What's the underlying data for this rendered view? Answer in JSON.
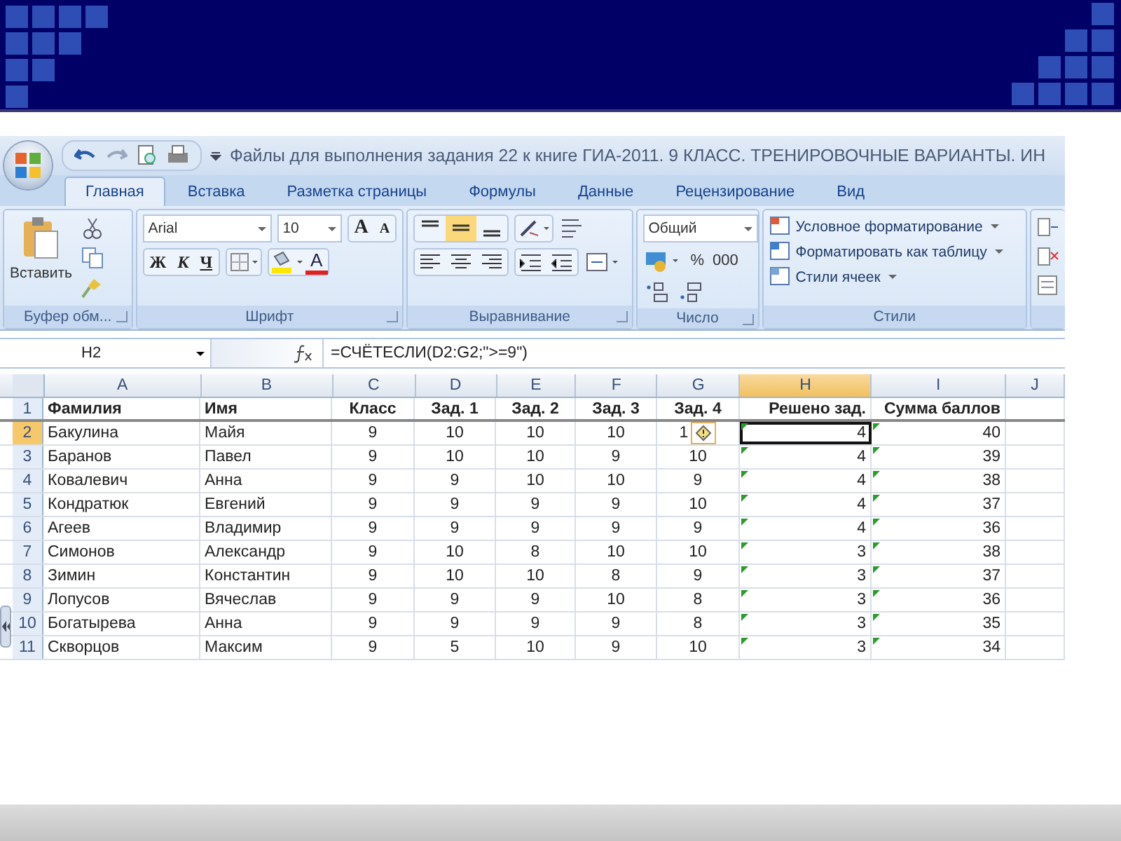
{
  "excel": {
    "title": "Файлы для выполнения задания 22 к книге ГИА-2011. 9 КЛАСС. ТРЕНИРОВОЧНЫЕ ВАРИАНТЫ. ИН",
    "tabs": [
      {
        "label": "Главная",
        "selected": true
      },
      {
        "label": "Вставка",
        "selected": false
      },
      {
        "label": "Разметка страницы",
        "selected": false
      },
      {
        "label": "Формулы",
        "selected": false
      },
      {
        "label": "Данные",
        "selected": false
      },
      {
        "label": "Рецензирование",
        "selected": false
      },
      {
        "label": "Вид",
        "selected": false
      }
    ],
    "clipboard": {
      "paste": "Вставить",
      "group": "Буфер обм..."
    },
    "font": {
      "family": "Arial",
      "size": "10",
      "grow": "A",
      "shrink": "A",
      "bold": "Ж",
      "italic": "К",
      "underline": "Ч",
      "font_color": "A",
      "group": "Шрифт"
    },
    "alignment": {
      "vertical": [
        {
          "kind": "top",
          "selected": false
        },
        {
          "kind": "middle",
          "selected": true
        },
        {
          "kind": "bottom",
          "selected": false
        }
      ],
      "group": "Выравнивание"
    },
    "number": {
      "format": "Общий",
      "percent": "%",
      "thousands": "000",
      "group": "Число"
    },
    "styles": {
      "items": [
        "Условное форматирование",
        "Форматировать как таблицу",
        "Стили ячеек"
      ],
      "group": "Стили"
    },
    "name_box": "H2",
    "formula": "=СЧЁТЕСЛИ(D2:G2;\">=9\")",
    "columns": [
      {
        "letter": "A",
        "selected": false,
        "kind": "text",
        "flagged": false
      },
      {
        "letter": "B",
        "selected": false,
        "kind": "text",
        "flagged": false
      },
      {
        "letter": "C",
        "selected": false,
        "kind": "score",
        "flagged": false
      },
      {
        "letter": "D",
        "selected": false,
        "kind": "score",
        "flagged": false
      },
      {
        "letter": "E",
        "selected": false,
        "kind": "score",
        "flagged": false
      },
      {
        "letter": "F",
        "selected": false,
        "kind": "score",
        "flagged": false
      },
      {
        "letter": "G",
        "selected": false,
        "kind": "score",
        "flagged": false
      },
      {
        "letter": "H",
        "selected": true,
        "kind": "result",
        "flagged": true
      },
      {
        "letter": "I",
        "selected": false,
        "kind": "result",
        "flagged": true
      },
      {
        "letter": "J",
        "selected": false,
        "kind": "text",
        "flagged": false
      }
    ],
    "rows": [
      {
        "number": "1",
        "selected": false,
        "kind": "header",
        "cells": [
          "Фамилия",
          "Имя",
          "Класс",
          "Зад. 1",
          "Зад. 2",
          "Зад. 3",
          "Зад. 4",
          "Решено зад.",
          "Сумма баллов"
        ]
      },
      {
        "number": "2",
        "selected": true,
        "kind": "data",
        "cells": [
          "Бакулина",
          "Майя",
          "9",
          "10",
          "10",
          "10",
          {
            "text": "1",
            "smart_tag": true
          },
          "4",
          "40"
        ]
      },
      {
        "number": "3",
        "selected": false,
        "kind": "data",
        "cells": [
          "Баранов",
          "Павел",
          "9",
          "10",
          "10",
          "9",
          "10",
          "4",
          "39"
        ]
      },
      {
        "number": "4",
        "selected": false,
        "kind": "data",
        "cells": [
          "Ковалевич",
          "Анна",
          "9",
          "9",
          "10",
          "10",
          "9",
          "4",
          "38"
        ]
      },
      {
        "number": "5",
        "selected": false,
        "kind": "data",
        "cells": [
          "Кондратюк",
          "Евгений",
          "9",
          "9",
          "9",
          "9",
          "10",
          "4",
          "37"
        ]
      },
      {
        "number": "6",
        "selected": false,
        "kind": "data",
        "cells": [
          "Агеев",
          "Владимир",
          "9",
          "9",
          "9",
          "9",
          "9",
          "4",
          "36"
        ]
      },
      {
        "number": "7",
        "selected": false,
        "kind": "data",
        "cells": [
          "Симонов",
          "Александр",
          "9",
          "10",
          "8",
          "10",
          "10",
          "3",
          "38"
        ]
      },
      {
        "number": "8",
        "selected": false,
        "kind": "data",
        "cells": [
          "Зимин",
          "Константин",
          "9",
          "10",
          "10",
          "8",
          "9",
          "3",
          "37"
        ]
      },
      {
        "number": "9",
        "selected": false,
        "kind": "data",
        "cells": [
          "Лопусов",
          "Вячеслав",
          "9",
          "9",
          "9",
          "10",
          "8",
          "3",
          "36"
        ]
      },
      {
        "number": "10",
        "selected": false,
        "kind": "data",
        "cells": [
          "Богатырева",
          "Анна",
          "9",
          "9",
          "9",
          "9",
          "8",
          "3",
          "35"
        ]
      },
      {
        "number": "11",
        "selected": false,
        "kind": "data",
        "cells": [
          "Скворцов",
          "Максим",
          "9",
          "5",
          "10",
          "9",
          "10",
          "3",
          "34"
        ]
      }
    ]
  }
}
